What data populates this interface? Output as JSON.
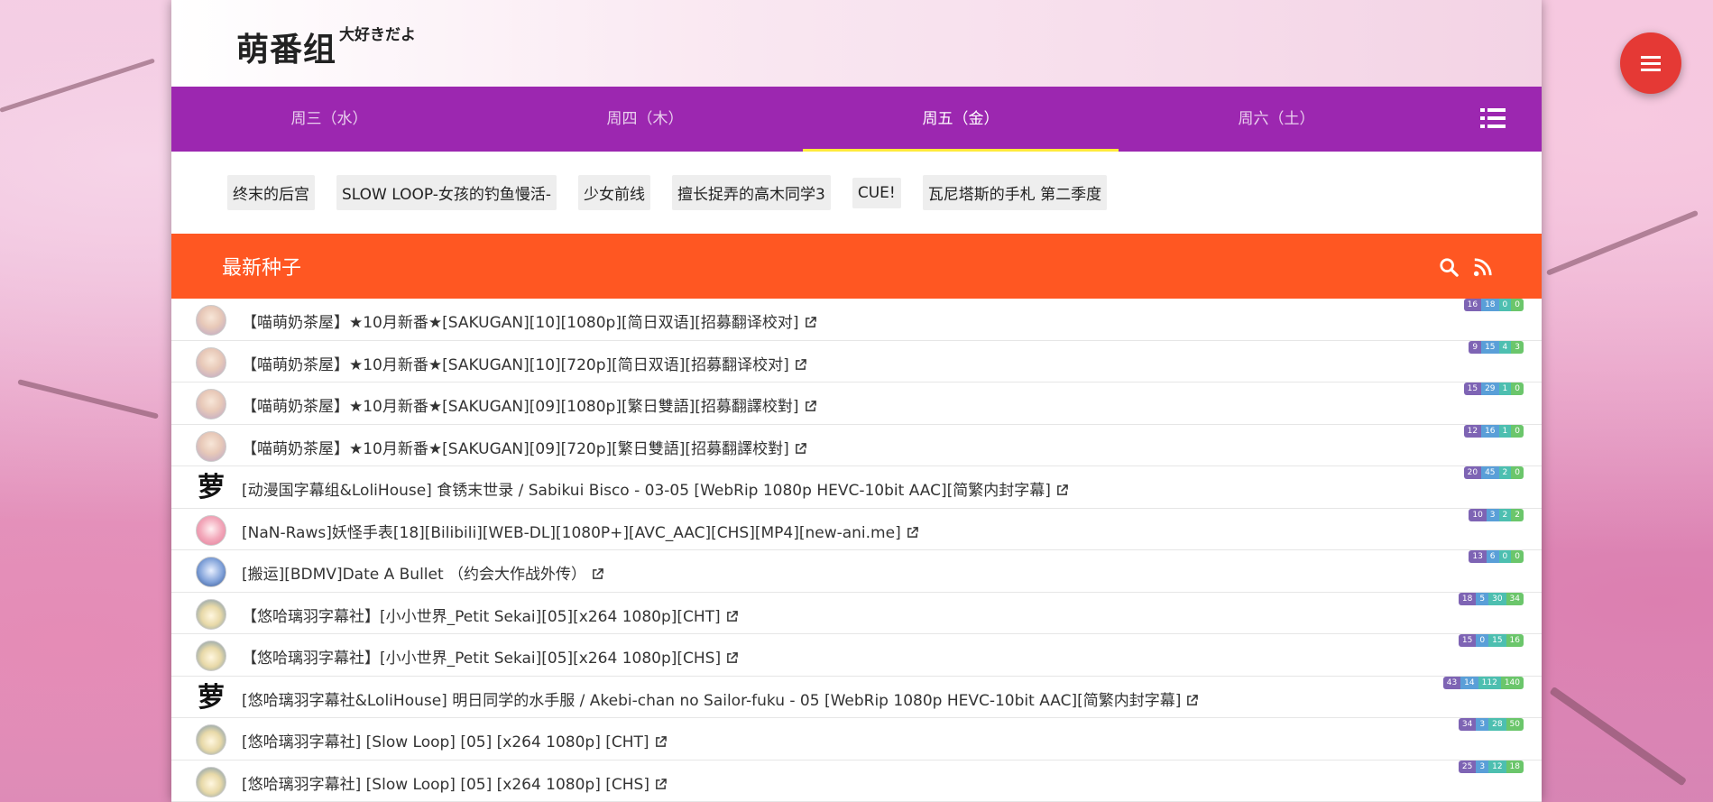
{
  "site": {
    "title": "萌番组",
    "subtitle": "大好きだよ"
  },
  "tabs": [
    {
      "label": "周三（水）",
      "active": false
    },
    {
      "label": "周四（木）",
      "active": false
    },
    {
      "label": "周五（金）",
      "active": true
    },
    {
      "label": "周六（土）",
      "active": false
    }
  ],
  "bangumi": [
    "终末的后宫",
    "SLOW LOOP-女孩的钓鱼慢活-",
    "少女前线",
    "擅长捉弄的高木同学3",
    "CUE!",
    "瓦尼塔斯的手札 第二季度"
  ],
  "latest": {
    "title": "最新种子",
    "rows": [
      {
        "avatar": "anime-girl-avatar",
        "title": "【喵萌奶茶屋】★10月新番★[SAKUGAN][10][1080p][简日双语][招募翻译校对]",
        "stats": [
          "16",
          "18",
          "0",
          "0"
        ]
      },
      {
        "avatar": "anime-girl-avatar",
        "title": "【喵萌奶茶屋】★10月新番★[SAKUGAN][10][720p][简日双语][招募翻译校对]",
        "stats": [
          "9",
          "15",
          "4",
          "3"
        ]
      },
      {
        "avatar": "anime-girl-avatar",
        "title": "【喵萌奶茶屋】★10月新番★[SAKUGAN][09][1080p][繁日雙語][招募翻譯校對]",
        "stats": [
          "15",
          "29",
          "1",
          "0"
        ]
      },
      {
        "avatar": "anime-girl-avatar",
        "title": "【喵萌奶茶屋】★10月新番★[SAKUGAN][09][720p][繁日雙語][招募翻譯校對]",
        "stats": [
          "12",
          "16",
          "1",
          "0"
        ]
      },
      {
        "avatar": "meng-glyph",
        "title": "[动漫国字幕组&LoliHouse] 食锈末世录 / Sabikui Bisco - 03-05 [WebRip 1080p HEVC-10bit AAC][简繁内封字幕]",
        "stats": [
          "20",
          "45",
          "2",
          "0"
        ]
      },
      {
        "avatar": "pink-hair-avatar",
        "title": "[NaN-Raws]妖怪手表[18][Bilibili][WEB-DL][1080P+][AVC_AAC][CHS][MP4][new-ani.me]",
        "stats": [
          "10",
          "3",
          "2",
          "2"
        ]
      },
      {
        "avatar": "blue-anime-avatar",
        "title": "[搬运][BDMV]Date A Bullet （约会大作战外传）",
        "stats": [
          "13",
          "6",
          "0",
          "0"
        ]
      },
      {
        "avatar": "blonde-girl-avatar",
        "title": "【悠哈璃羽字幕社】[小小世界_Petit Sekai][05][x264 1080p][CHT]",
        "stats": [
          "18",
          "5",
          "30",
          "34"
        ]
      },
      {
        "avatar": "blonde-girl-avatar",
        "title": "【悠哈璃羽字幕社】[小小世界_Petit Sekai][05][x264 1080p][CHS]",
        "stats": [
          "15",
          "0",
          "15",
          "16"
        ]
      },
      {
        "avatar": "meng-glyph",
        "title": "[悠哈璃羽字幕社&LoliHouse] 明日同学的水手服 / Akebi-chan no Sailor-fuku - 05 [WebRip 1080p HEVC-10bit AAC][简繁内封字幕]",
        "stats": [
          "43",
          "14",
          "112",
          "140"
        ]
      },
      {
        "avatar": "blonde-girl-avatar",
        "title": "[悠哈璃羽字幕社] [Slow Loop] [05] [x264 1080p] [CHT]",
        "stats": [
          "34",
          "3",
          "28",
          "50"
        ]
      },
      {
        "avatar": "blonde-girl-avatar",
        "title": "[悠哈璃羽字幕社] [Slow Loop] [05] [x264 1080p] [CHS]",
        "stats": [
          "25",
          "3",
          "12",
          "18"
        ]
      }
    ]
  },
  "meng_glyph": "萝",
  "colors": {
    "purple": "#9c27b0",
    "orange": "#ff5722",
    "fab": "#e53935"
  }
}
